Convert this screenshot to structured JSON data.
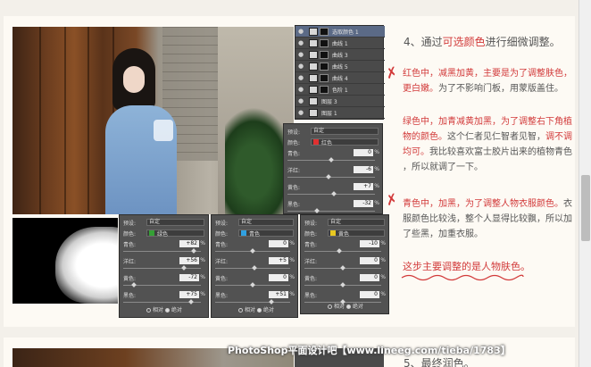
{
  "step4": {
    "num": "4、通过",
    "highlight": "可选颜色",
    "rest": "进行细微调整。"
  },
  "layers": [
    {
      "name": "选取颜色 1",
      "active": true
    },
    {
      "name": "曲线 1",
      "active": false
    },
    {
      "name": "曲线 3",
      "active": false
    },
    {
      "name": "曲线 5",
      "active": false
    },
    {
      "name": "曲线 4",
      "active": false
    },
    {
      "name": "色阶 1",
      "active": false
    },
    {
      "name": "图层 3",
      "active": false
    },
    {
      "name": "图层 1",
      "active": false
    }
  ],
  "adj_common": {
    "preset_label": "预设:",
    "preset_value": "自定",
    "colors_label": "颜色:",
    "relative": "相对",
    "absolute": "绝对",
    "pct": "%"
  },
  "panels": [
    {
      "color_name": "红色",
      "swatch": "#e03030",
      "rows": [
        {
          "label": "青色:",
          "value": "0",
          "frac": 0.5
        },
        {
          "label": "洋红:",
          "value": "-6",
          "frac": 0.47
        },
        {
          "label": "黄色:",
          "value": "+7",
          "frac": 0.535
        },
        {
          "label": "黑色:",
          "value": "-32",
          "frac": 0.34
        }
      ]
    },
    {
      "color_name": "绿色",
      "swatch": "#35a035",
      "rows": [
        {
          "label": "青色:",
          "value": "+82",
          "frac": 0.91
        },
        {
          "label": "洋红:",
          "value": "+56",
          "frac": 0.78
        },
        {
          "label": "黄色:",
          "value": "-72",
          "frac": 0.14
        },
        {
          "label": "黑色:",
          "value": "+75",
          "frac": 0.875
        }
      ]
    },
    {
      "color_name": "青色",
      "swatch": "#30a0e0",
      "rows": [
        {
          "label": "青色:",
          "value": "0",
          "frac": 0.5
        },
        {
          "label": "洋红:",
          "value": "+5",
          "frac": 0.525
        },
        {
          "label": "黄色:",
          "value": "0",
          "frac": 0.5
        },
        {
          "label": "黑色:",
          "value": "+51",
          "frac": 0.755
        }
      ]
    },
    {
      "color_name": "黄色",
      "swatch": "#e8c820",
      "rows": [
        {
          "label": "青色:",
          "value": "-10",
          "frac": 0.45
        },
        {
          "label": "洋红:",
          "value": "0",
          "frac": 0.5
        },
        {
          "label": "黄色:",
          "value": "0",
          "frac": 0.5
        },
        {
          "label": "黑色:",
          "value": "0",
          "frac": 0.5
        }
      ]
    }
  ],
  "notes": {
    "red_a": "红色中，减黑加黄，主要是为了调整肤色，",
    "red_b": "更白嫩。",
    "red_c": "为了不影响门板，用蒙版盖住。",
    "green_a": "绿色中，加青减黄加黑，为了调整右下角植",
    "green_b": "物的颜色。",
    "green_c": "这个仁者见仁智者见智，",
    "green_d": "调不调",
    "green_e": "均可。",
    "green_f": "我比较喜欢富士胶片出来的植物青色",
    "green_g": "，所以就调了一下。",
    "cyan_a": "青色中，加黑，为了调整人物衣服颜色。",
    "cyan_b": "衣",
    "cyan_c": "服颜色比较浅，整个人显得比较飘，所以加",
    "cyan_d": "了些黑，加重衣服。"
  },
  "summary": "这步主要调整的是人物肤色。",
  "step5": "5、最终润色。",
  "watermark": "PhotoShop平面设计吧【www.lineeg.com/tieba/1783】",
  "colors": {
    "accent_red": "#d23a3a",
    "text_gray": "#555555",
    "panel_bg": "#525252"
  }
}
